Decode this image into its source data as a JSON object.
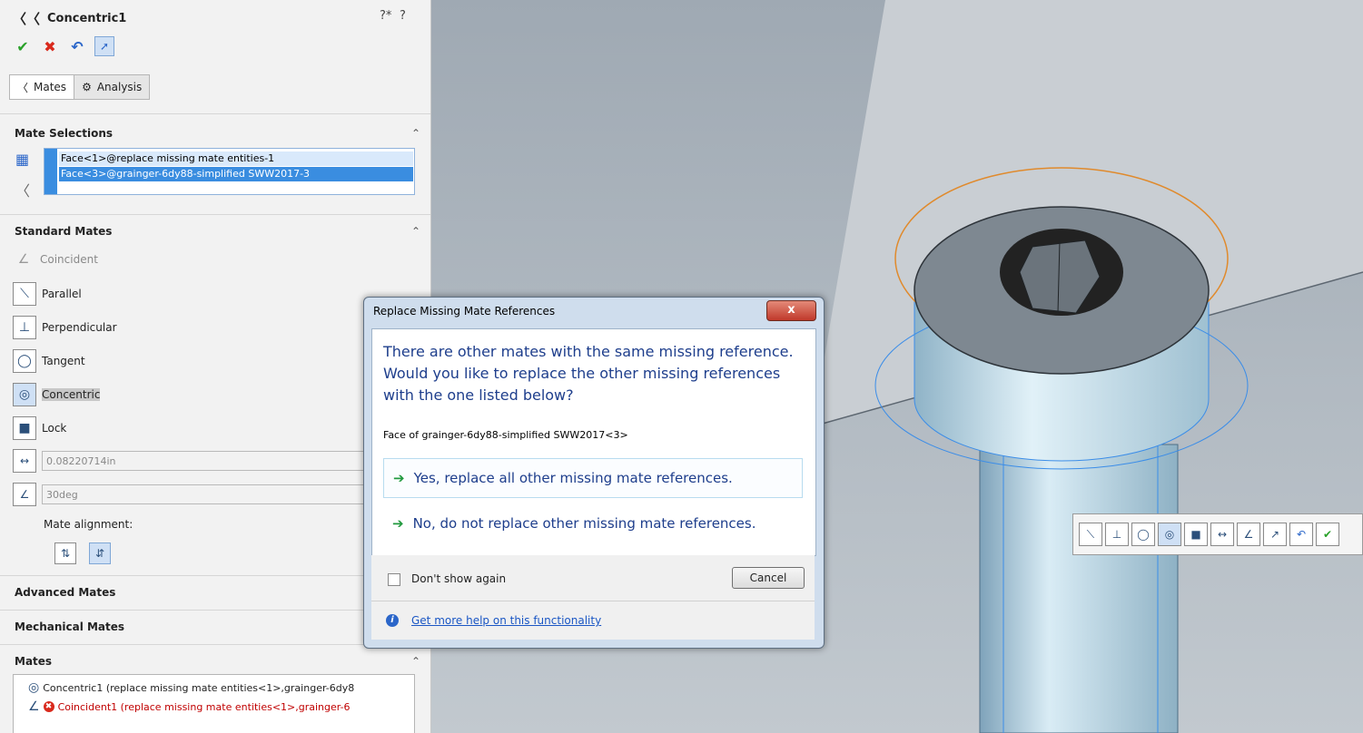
{
  "property_manager": {
    "title": "Concentric1",
    "help_icons": [
      "?*",
      "?"
    ],
    "tabs": [
      {
        "label": "Mates"
      },
      {
        "label": "Analysis"
      }
    ],
    "mate_selections": {
      "header": "Mate Selections",
      "items": [
        "Face<1>@replace missing mate entities-1",
        "Face<3>@grainger-6dy88-simplified SWW2017-3"
      ]
    },
    "standard_mates": {
      "header": "Standard Mates",
      "items": [
        {
          "label": "Coincident",
          "icon": "coincident-icon",
          "enabled": false
        },
        {
          "label": "Parallel",
          "icon": "parallel-icon",
          "enabled": true
        },
        {
          "label": "Perpendicular",
          "icon": "perpendicular-icon",
          "enabled": true
        },
        {
          "label": "Tangent",
          "icon": "tangent-icon",
          "enabled": true
        },
        {
          "label": "Concentric",
          "icon": "concentric-icon",
          "enabled": true,
          "selected": true
        },
        {
          "label": "Lock",
          "icon": "lock-icon",
          "enabled": true
        }
      ],
      "distance_value": "0.08220714in",
      "angle_value": "30deg",
      "alignment_label": "Mate alignment:"
    },
    "advanced_mates": {
      "header": "Advanced Mates"
    },
    "mechanical_mates": {
      "header": "Mechanical Mates"
    },
    "mates": {
      "header": "Mates",
      "items": [
        {
          "label": "Concentric1 (replace missing mate entities<1>,grainger-6dy8",
          "error": false
        },
        {
          "label": "Coincident1 (replace missing mate entities<1>,grainger-6",
          "error": true
        }
      ]
    }
  },
  "dialog": {
    "title": "Replace Missing Mate References",
    "close_label": "x",
    "message": "There are other mates with the same missing reference. Would you like to replace the other missing references with the one listed below?",
    "reference": "Face of grainger-6dy88-simplified SWW2017<3>",
    "options": [
      "Yes, replace all other missing mate references.",
      "No, do not replace other missing mate references."
    ],
    "dont_show": "Don't show again",
    "cancel": "Cancel",
    "help_link": "Get more help on this functionality"
  },
  "colors": {
    "accent": "#3a8de0",
    "dialog_text": "#1e3e8c",
    "ok_green": "#229a3f",
    "cancel_red": "#d9291c",
    "viewport_bg": "#b5bec6"
  }
}
